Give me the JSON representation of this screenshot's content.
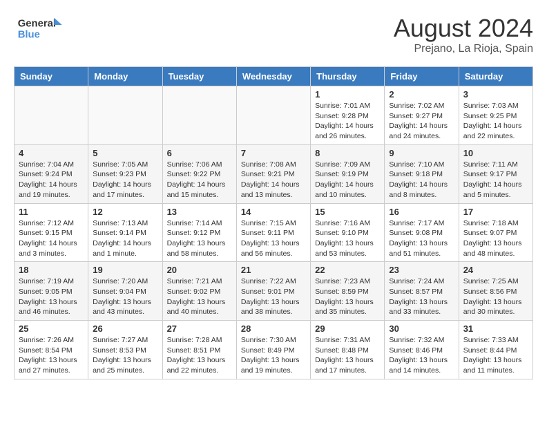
{
  "header": {
    "logo_line1": "General",
    "logo_line2": "Blue",
    "month_year": "August 2024",
    "location": "Prejano, La Rioja, Spain"
  },
  "weekdays": [
    "Sunday",
    "Monday",
    "Tuesday",
    "Wednesday",
    "Thursday",
    "Friday",
    "Saturday"
  ],
  "weeks": [
    [
      {
        "day": "",
        "info": ""
      },
      {
        "day": "",
        "info": ""
      },
      {
        "day": "",
        "info": ""
      },
      {
        "day": "",
        "info": ""
      },
      {
        "day": "1",
        "info": "Sunrise: 7:01 AM\nSunset: 9:28 PM\nDaylight: 14 hours\nand 26 minutes."
      },
      {
        "day": "2",
        "info": "Sunrise: 7:02 AM\nSunset: 9:27 PM\nDaylight: 14 hours\nand 24 minutes."
      },
      {
        "day": "3",
        "info": "Sunrise: 7:03 AM\nSunset: 9:25 PM\nDaylight: 14 hours\nand 22 minutes."
      }
    ],
    [
      {
        "day": "4",
        "info": "Sunrise: 7:04 AM\nSunset: 9:24 PM\nDaylight: 14 hours\nand 19 minutes."
      },
      {
        "day": "5",
        "info": "Sunrise: 7:05 AM\nSunset: 9:23 PM\nDaylight: 14 hours\nand 17 minutes."
      },
      {
        "day": "6",
        "info": "Sunrise: 7:06 AM\nSunset: 9:22 PM\nDaylight: 14 hours\nand 15 minutes."
      },
      {
        "day": "7",
        "info": "Sunrise: 7:08 AM\nSunset: 9:21 PM\nDaylight: 14 hours\nand 13 minutes."
      },
      {
        "day": "8",
        "info": "Sunrise: 7:09 AM\nSunset: 9:19 PM\nDaylight: 14 hours\nand 10 minutes."
      },
      {
        "day": "9",
        "info": "Sunrise: 7:10 AM\nSunset: 9:18 PM\nDaylight: 14 hours\nand 8 minutes."
      },
      {
        "day": "10",
        "info": "Sunrise: 7:11 AM\nSunset: 9:17 PM\nDaylight: 14 hours\nand 5 minutes."
      }
    ],
    [
      {
        "day": "11",
        "info": "Sunrise: 7:12 AM\nSunset: 9:15 PM\nDaylight: 14 hours\nand 3 minutes."
      },
      {
        "day": "12",
        "info": "Sunrise: 7:13 AM\nSunset: 9:14 PM\nDaylight: 14 hours\nand 1 minute."
      },
      {
        "day": "13",
        "info": "Sunrise: 7:14 AM\nSunset: 9:12 PM\nDaylight: 13 hours\nand 58 minutes."
      },
      {
        "day": "14",
        "info": "Sunrise: 7:15 AM\nSunset: 9:11 PM\nDaylight: 13 hours\nand 56 minutes."
      },
      {
        "day": "15",
        "info": "Sunrise: 7:16 AM\nSunset: 9:10 PM\nDaylight: 13 hours\nand 53 minutes."
      },
      {
        "day": "16",
        "info": "Sunrise: 7:17 AM\nSunset: 9:08 PM\nDaylight: 13 hours\nand 51 minutes."
      },
      {
        "day": "17",
        "info": "Sunrise: 7:18 AM\nSunset: 9:07 PM\nDaylight: 13 hours\nand 48 minutes."
      }
    ],
    [
      {
        "day": "18",
        "info": "Sunrise: 7:19 AM\nSunset: 9:05 PM\nDaylight: 13 hours\nand 46 minutes."
      },
      {
        "day": "19",
        "info": "Sunrise: 7:20 AM\nSunset: 9:04 PM\nDaylight: 13 hours\nand 43 minutes."
      },
      {
        "day": "20",
        "info": "Sunrise: 7:21 AM\nSunset: 9:02 PM\nDaylight: 13 hours\nand 40 minutes."
      },
      {
        "day": "21",
        "info": "Sunrise: 7:22 AM\nSunset: 9:01 PM\nDaylight: 13 hours\nand 38 minutes."
      },
      {
        "day": "22",
        "info": "Sunrise: 7:23 AM\nSunset: 8:59 PM\nDaylight: 13 hours\nand 35 minutes."
      },
      {
        "day": "23",
        "info": "Sunrise: 7:24 AM\nSunset: 8:57 PM\nDaylight: 13 hours\nand 33 minutes."
      },
      {
        "day": "24",
        "info": "Sunrise: 7:25 AM\nSunset: 8:56 PM\nDaylight: 13 hours\nand 30 minutes."
      }
    ],
    [
      {
        "day": "25",
        "info": "Sunrise: 7:26 AM\nSunset: 8:54 PM\nDaylight: 13 hours\nand 27 minutes."
      },
      {
        "day": "26",
        "info": "Sunrise: 7:27 AM\nSunset: 8:53 PM\nDaylight: 13 hours\nand 25 minutes."
      },
      {
        "day": "27",
        "info": "Sunrise: 7:28 AM\nSunset: 8:51 PM\nDaylight: 13 hours\nand 22 minutes."
      },
      {
        "day": "28",
        "info": "Sunrise: 7:30 AM\nSunset: 8:49 PM\nDaylight: 13 hours\nand 19 minutes."
      },
      {
        "day": "29",
        "info": "Sunrise: 7:31 AM\nSunset: 8:48 PM\nDaylight: 13 hours\nand 17 minutes."
      },
      {
        "day": "30",
        "info": "Sunrise: 7:32 AM\nSunset: 8:46 PM\nDaylight: 13 hours\nand 14 minutes."
      },
      {
        "day": "31",
        "info": "Sunrise: 7:33 AM\nSunset: 8:44 PM\nDaylight: 13 hours\nand 11 minutes."
      }
    ]
  ]
}
